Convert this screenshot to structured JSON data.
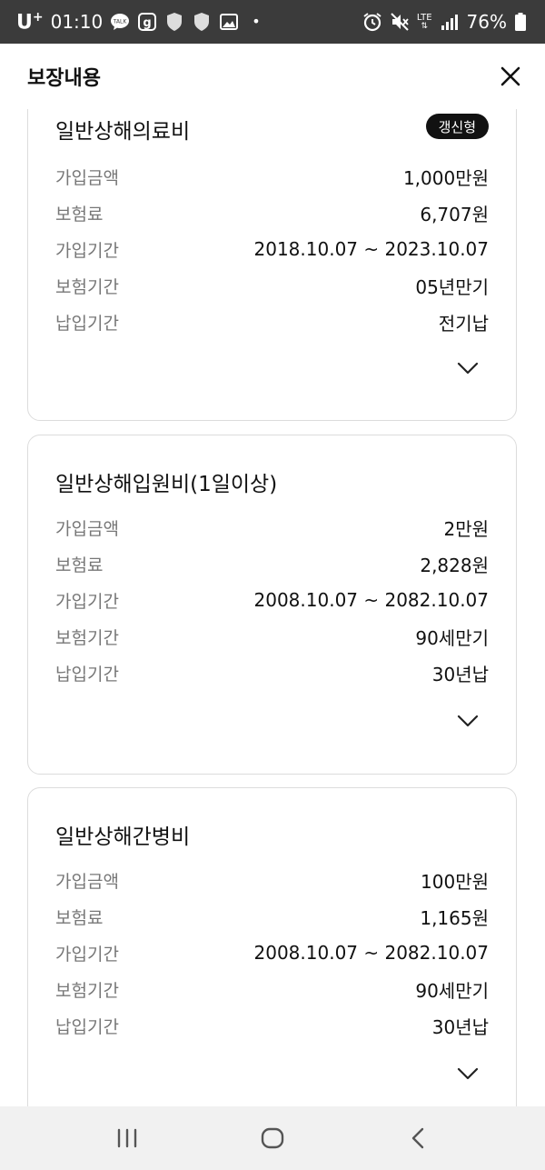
{
  "status_bar": {
    "carrier": "U",
    "carrier_sup": "+",
    "time": "01:10",
    "network": "LTE",
    "battery": "76%"
  },
  "header": {
    "title": "보장내용"
  },
  "cards": [
    {
      "title": "일반상해의료비",
      "badge": "갱신형",
      "rows": [
        {
          "label": "가입금액",
          "value": "1,000만원"
        },
        {
          "label": "보험료",
          "value": "6,707원"
        },
        {
          "label": "가입기간",
          "value": "2018.10.07 ~ 2023.10.07"
        },
        {
          "label": "보험기간",
          "value": "05년만기"
        },
        {
          "label": "납입기간",
          "value": "전기납"
        }
      ]
    },
    {
      "title": "일반상해입원비(1일이상)",
      "rows": [
        {
          "label": "가입금액",
          "value": "2만원"
        },
        {
          "label": "보험료",
          "value": "2,828원"
        },
        {
          "label": "가입기간",
          "value": "2008.10.07 ~ 2082.10.07"
        },
        {
          "label": "보험기간",
          "value": "90세만기"
        },
        {
          "label": "납입기간",
          "value": "30년납"
        }
      ]
    },
    {
      "title": "일반상해간병비",
      "rows": [
        {
          "label": "가입금액",
          "value": "100만원"
        },
        {
          "label": "보험료",
          "value": "1,165원"
        },
        {
          "label": "가입기간",
          "value": "2008.10.07 ~ 2082.10.07"
        },
        {
          "label": "보험기간",
          "value": "90세만기"
        },
        {
          "label": "납입기간",
          "value": "30년납"
        }
      ]
    }
  ],
  "icons": {
    "close": "close-icon",
    "expand": "chevron-down-icon",
    "nav_recent": "recent-apps-icon",
    "nav_home": "home-icon",
    "nav_back": "back-icon"
  },
  "colors": {
    "status_bar_bg": "#3b3b3b",
    "badge_bg": "#111111",
    "label_text": "#777777",
    "card_border": "#dcdcdc",
    "nav_bar_bg": "#f1f1f1"
  }
}
